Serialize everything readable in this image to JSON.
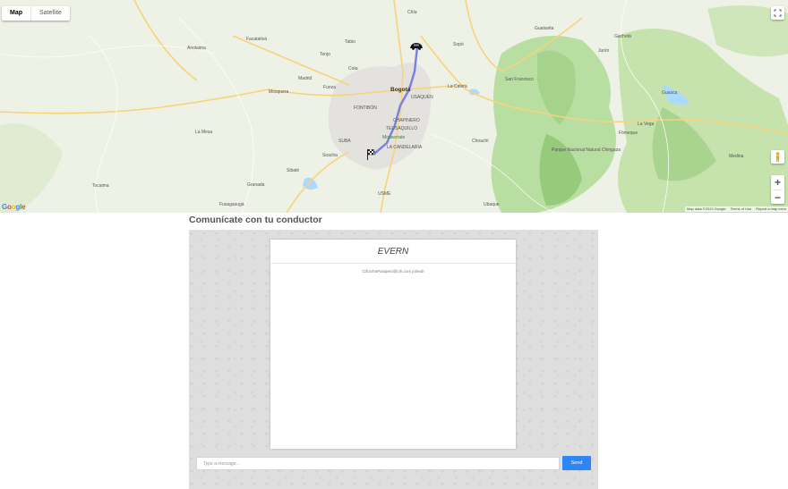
{
  "map": {
    "type_buttons": [
      {
        "label": "Map",
        "active": true
      },
      {
        "label": "Satellite",
        "active": false
      }
    ],
    "icons": {
      "fullscreen": "fullscreen-icon",
      "pegman": "pegman-icon",
      "zoom_in": "+",
      "zoom_out": "−",
      "car": "car-icon",
      "destination": "checkered-flag-icon"
    },
    "logo": "Google",
    "attribution": [
      "Map data ©2019 Google",
      "Terms of Use",
      "Report a map error"
    ],
    "route_color": "#7b82e0",
    "labels": {
      "bogota": "Bogotá",
      "chia": "Chía",
      "usaquen": "USAQUÉN",
      "chapinero": "CHAPINERO",
      "teusaquillo": "TEUSAQUILLO",
      "la_candelaria": "LA CANDELARIA",
      "monserrate": "Monserrate",
      "fontibon": "FONTIBÓN",
      "soacha": "Soacha",
      "funza": "Funza",
      "mosquera": "Mosquera",
      "madrid": "Madrid",
      "cota": "Cota",
      "suba": "SUBA",
      "la_calera": "La Calera",
      "usme": "USME",
      "facatativa": "Facatativá",
      "tabio": "Tabio",
      "tenjo": "Tenjo",
      "sopo": "Sopó",
      "guasca": "Guasca",
      "la_vega": "La Vega",
      "san_francisco": "San Francisco",
      "choachi": "Choachí",
      "ubaque": "Ubaque",
      "fomeque": "Fómeque",
      "parque": "Parque Nacional Natural Chingaza",
      "sibate": "Sibaté",
      "granada": "Granada",
      "fusagasuga": "Fusagasugá",
      "anolaima": "Anolaima",
      "la_mesa": "La Mesa",
      "tocaima": "Tocaima",
      "junin": "Junín",
      "gacheta": "Gachetá",
      "guatavita": "Guatavita",
      "medina": "Medina"
    }
  },
  "chat": {
    "title": "Comunícate con tu conductor",
    "header": "EVERN",
    "system_message": "CifrJohnPasajero@crk.com joined!",
    "input_placeholder": "Type a message...",
    "send_label": "Send"
  }
}
